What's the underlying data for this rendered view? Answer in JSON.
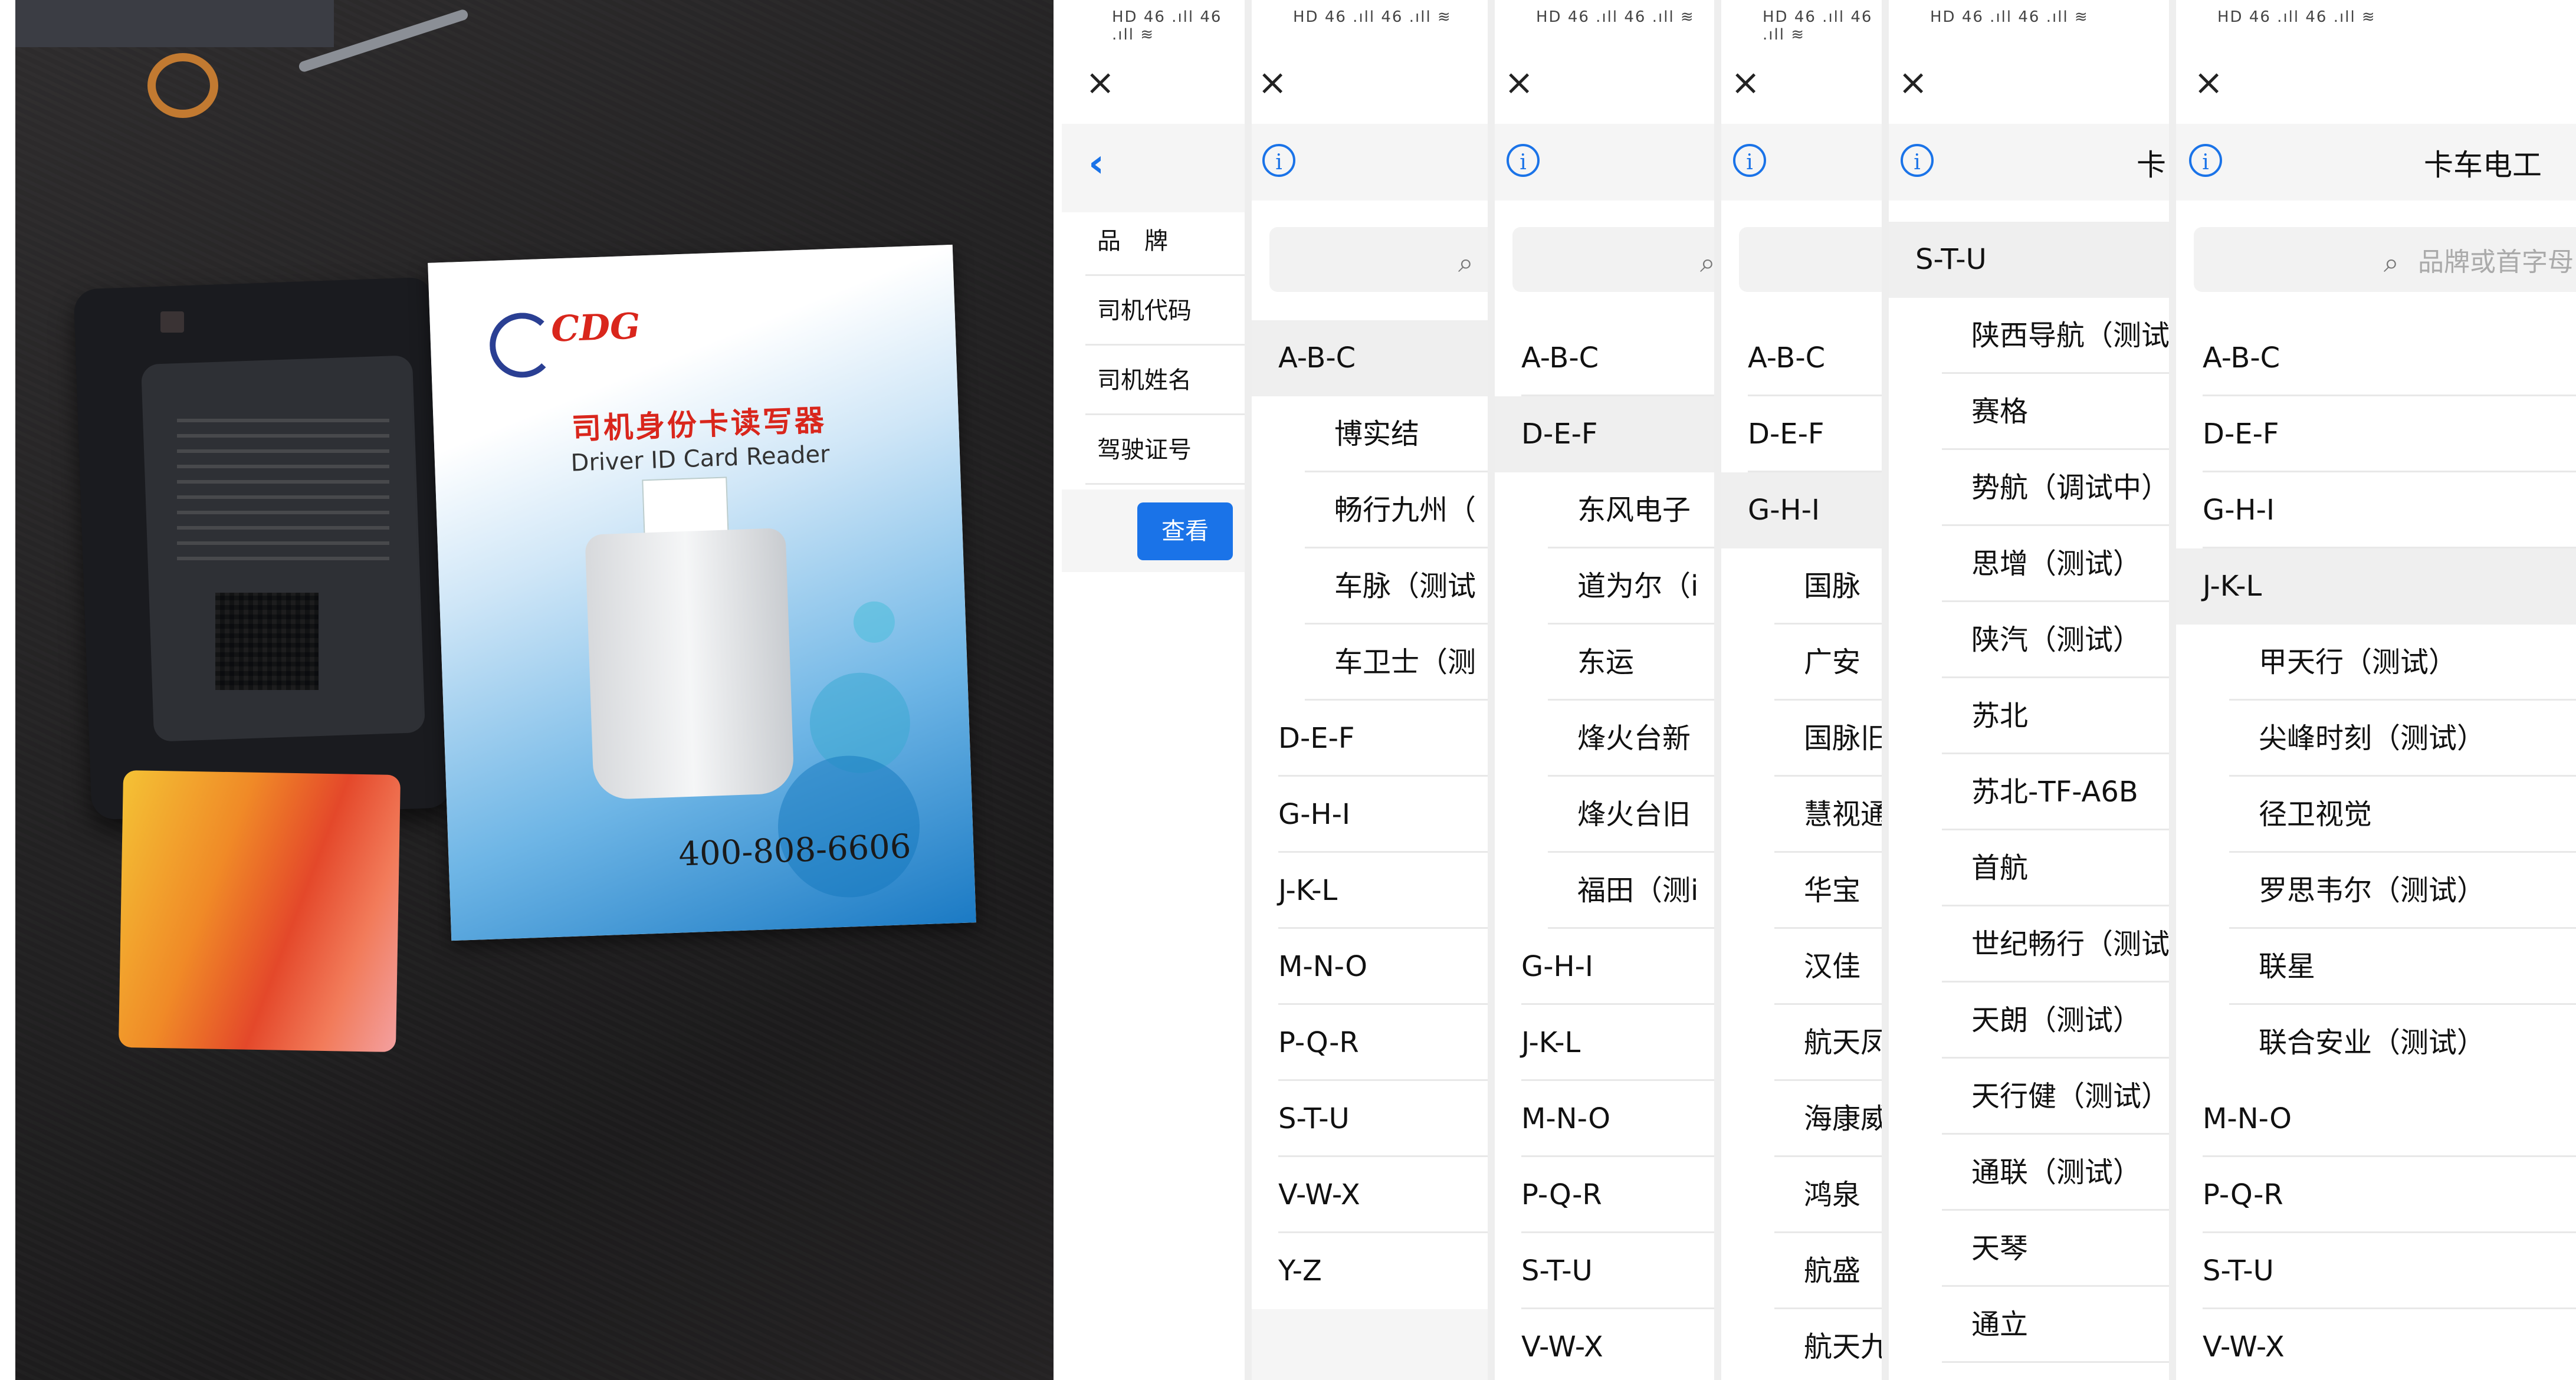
{
  "photo": {
    "box_title": "司机身份卡读写器",
    "box_subtitle": "Driver ID Card Reader",
    "box_logo": "CDG",
    "box_phone": "400-808-6606"
  },
  "status_bar": {
    "text": "HD 46 .ıll 46 .ıll ≋"
  },
  "close_icon": "×",
  "info_icon": "i",
  "search_icon": "⌕",
  "pane1": {
    "back_icon": "‹",
    "fields": [
      "品　牌",
      "司机代码",
      "司机姓名",
      "驾驶证号"
    ],
    "query_button": "查看"
  },
  "pane2": {
    "groups_before": [
      "A-B-C"
    ],
    "items": [
      "博实结",
      "畅行九州（",
      "车脉（测试",
      "车卫士（测"
    ],
    "groups_after": [
      "D-E-F",
      "G-H-I",
      "J-K-L",
      "M-N-O",
      "P-Q-R",
      "S-T-U",
      "V-W-X",
      "Y-Z"
    ]
  },
  "pane3": {
    "groups_before": [
      "A-B-C",
      "D-E-F"
    ],
    "items": [
      "东风电子",
      "道为尔（i",
      "东运",
      "烽火台新",
      "烽火台旧",
      "福田（测i"
    ],
    "groups_after": [
      "G-H-I",
      "J-K-L",
      "M-N-O",
      "P-Q-R",
      "S-T-U",
      "V-W-X"
    ]
  },
  "pane4": {
    "groups_before": [
      "A-B-C",
      "D-E-F",
      "G-H-I"
    ],
    "items": [
      "国脉",
      "广安",
      "国脉旧",
      "慧视通",
      "华宝",
      "汉佳",
      "航天凤",
      "海康威",
      "鸿泉",
      "航盛",
      "航天九"
    ]
  },
  "pane5": {
    "title_fragment": "卡",
    "group": "S-T-U",
    "items": [
      "陕西导航（测试",
      "赛格",
      "势航（调试中）",
      "思增（测试）",
      "陕汽（测试）",
      "苏北",
      "苏北-TF-A6B",
      "首航",
      "世纪畅行（测试",
      "天朗（测试）",
      "天行健（测试）",
      "通联（测试）",
      "天琴",
      "通立"
    ]
  },
  "pane6": {
    "title": "卡车电工",
    "search_placeholder": "品牌或首字母",
    "groups_before": [
      "A-B-C",
      "D-E-F",
      "G-H-I",
      "J-K-L"
    ],
    "items": [
      "甲天行（测试）",
      "尖峰时刻（测试）",
      "径卫视觉",
      "罗思韦尔（测试）",
      "联星",
      "联合安业（测试）"
    ],
    "groups_after": [
      "M-N-O",
      "P-Q-R",
      "S-T-U",
      "V-W-X"
    ]
  }
}
